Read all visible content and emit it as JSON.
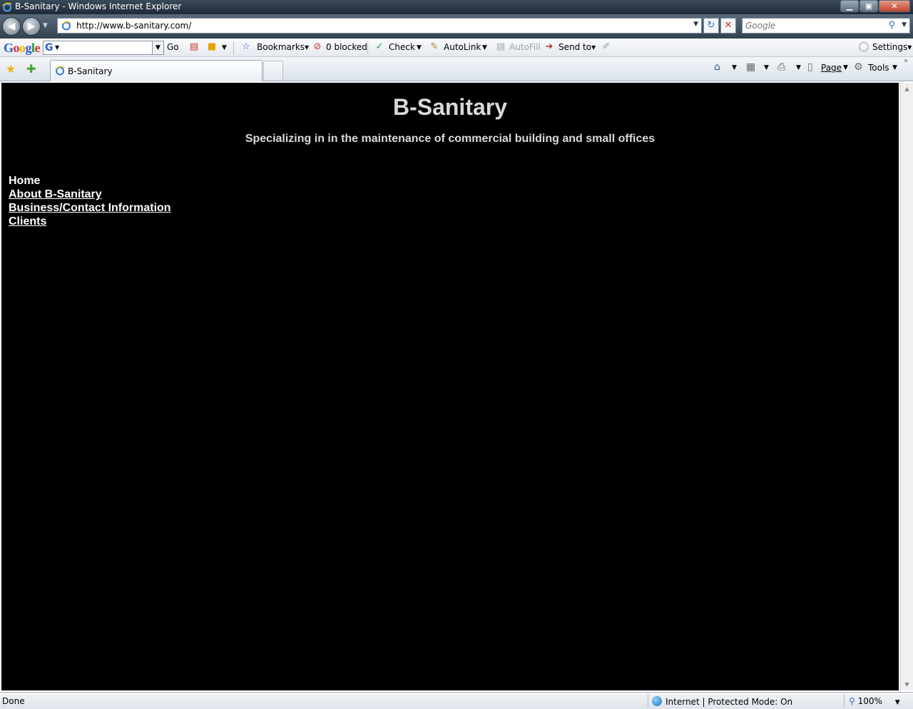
{
  "window": {
    "title": "B-Sanitary - Windows Internet Explorer",
    "controls": {
      "minimize": "▁",
      "maximize": "▣",
      "close": "✕"
    }
  },
  "navbar": {
    "back_glyph": "◀",
    "forward_glyph": "▶",
    "address": "http://www.b-sanitary.com/",
    "search_placeholder": "Google"
  },
  "google_toolbar": {
    "logo_letters": [
      "G",
      "o",
      "o",
      "g",
      "l",
      "e"
    ],
    "go_label": "Go",
    "bookmarks_label": "Bookmarks▾",
    "blocked_label": "0 blocked",
    "check_label": "Check",
    "autolink_label": "AutoLink",
    "autofill_label": "AutoFill",
    "sendto_label": "Send to▾",
    "settings_label": "Settings▾"
  },
  "tabbar": {
    "tab_label": "B-Sanitary",
    "page_label": "Page",
    "tools_label": "Tools"
  },
  "content": {
    "title": "B-Sanitary",
    "subtitle": "Specializing in in the maintenance of commercial building and small offices",
    "nav": {
      "home": "Home",
      "about": "About B-Sanitary",
      "business": "Business/Contact Information",
      "clients": "Clients"
    }
  },
  "statusbar": {
    "status": "Done",
    "zone": "Internet | Protected Mode: On",
    "zoom": "100%"
  },
  "colors": {
    "page_background": "#000000",
    "title_text": "#d9d9d9",
    "link_text": "#ffffff"
  }
}
